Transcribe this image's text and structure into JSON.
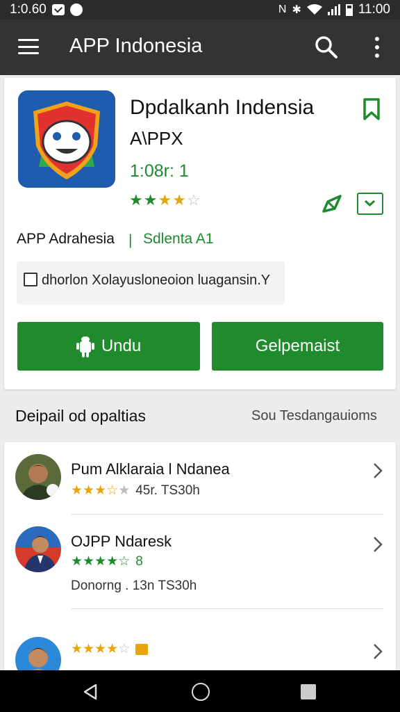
{
  "status_bar": {
    "time_left": "1:0.60",
    "time_right": "11:00",
    "icons": [
      "checkbox-notification-icon",
      "settings-notification-icon",
      "nfc-icon",
      "bluetooth-icon",
      "wifi-icon",
      "signal-icon",
      "battery-icon"
    ]
  },
  "app_bar": {
    "title": "APP Indonesia",
    "icons": [
      "menu-icon",
      "search-icon",
      "more-vert-icon"
    ]
  },
  "app": {
    "name": "Dpdalkanh Indensia",
    "developer": "A\\PPX",
    "version": "1:08r: 1",
    "rating_stars": 3.5,
    "publisher": "APP Adrahesia",
    "divider": "|",
    "category": "Sdlenta A1",
    "language_option": "dhorlon Xolayusloneoion luagansin.Y",
    "install_label": "Undu",
    "other_label": "Gelpemaist",
    "colors": {
      "accent_green": "#1f8b2c",
      "appbar": "#333333"
    }
  },
  "section": {
    "title": "Deipail od opaltias",
    "action": "Sou Tesdangauioms"
  },
  "reviews": [
    {
      "name": "Pum Alklaraia l Ndanea",
      "stars": 3.5,
      "meta": "45r. TS30h",
      "sub": ""
    },
    {
      "name": "OJPP Ndaresk",
      "stars": 4.5,
      "meta": "8",
      "sub": "Donorng . 13n TS30h"
    },
    {
      "name": "",
      "stars": 4,
      "meta": "",
      "sub": ""
    }
  ]
}
